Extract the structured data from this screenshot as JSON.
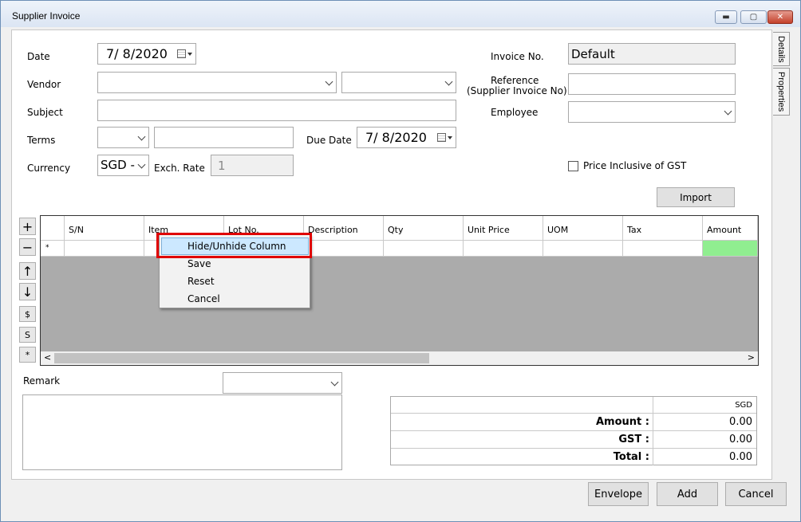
{
  "window": {
    "title": "Supplier Invoice"
  },
  "side_tabs": {
    "details": "Details",
    "properties": "Properties"
  },
  "form": {
    "date_label": "Date",
    "date_value": "7/  8/2020",
    "vendor_label": "Vendor",
    "subject_label": "Subject",
    "terms_label": "Terms",
    "due_date_label": "Due Date",
    "due_date_value": "7/  8/2020",
    "currency_label": "Currency",
    "currency_value": "SGD -",
    "exch_rate_label": "Exch. Rate",
    "exch_rate_value": "1",
    "invoice_no_label": "Invoice No.",
    "invoice_no_value": "Default",
    "reference_label_1": "Reference",
    "reference_label_2": "(Supplier Invoice No)",
    "employee_label": "Employee",
    "price_inclusive_label": "Price Inclusive of GST",
    "import_button": "Import"
  },
  "grid_tools": {
    "add": "+",
    "remove": "−",
    "move_up": "↑",
    "move_down": "↓",
    "dollar": "$",
    "s": "S",
    "star": "*"
  },
  "grid": {
    "columns": [
      "S/N",
      "Item",
      "Lot No.",
      "Description",
      "Qty",
      "Unit Price",
      "UOM",
      "Tax",
      "Amount"
    ],
    "new_row_marker": "*",
    "amount_cell_color": "#90ee90"
  },
  "context_menu": {
    "items": [
      "Hide/Unhide Column",
      "Save",
      "Reset",
      "Cancel"
    ],
    "highlight_color": "#cce8ff",
    "callout_color": "#e00000"
  },
  "remark": {
    "label": "Remark"
  },
  "totals": {
    "currency_header": "SGD",
    "amount_label": "Amount :",
    "amount_value": "0.00",
    "gst_label": "GST :",
    "gst_value": "0.00",
    "total_label": "Total :",
    "total_value": "0.00"
  },
  "footer": {
    "envelope": "Envelope",
    "add": "Add",
    "cancel": "Cancel"
  }
}
